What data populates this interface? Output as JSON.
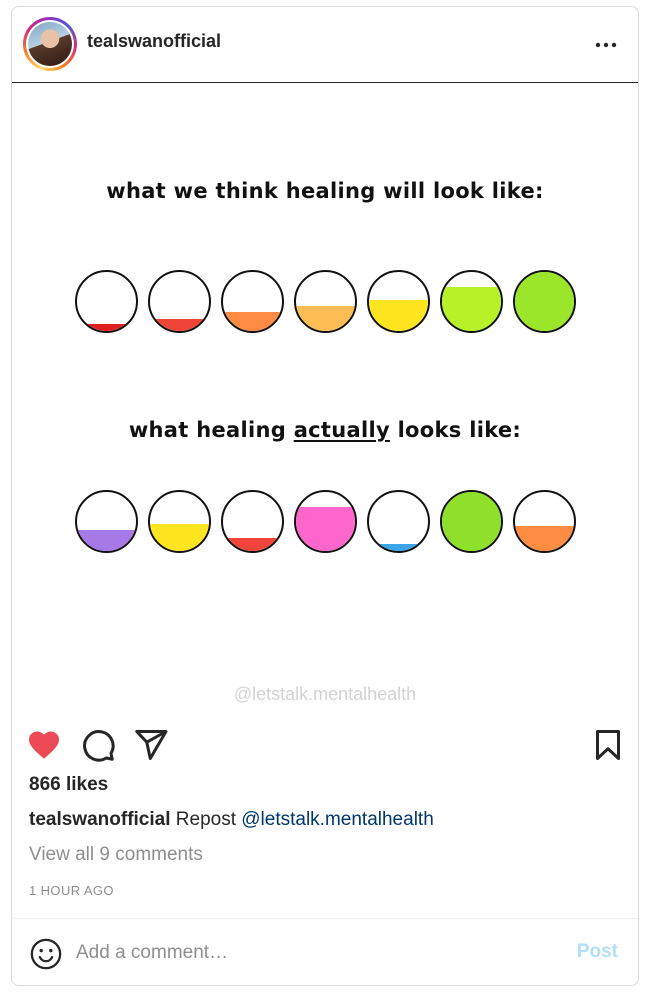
{
  "post": {
    "username": "tealswanofficial",
    "more_icon": "more-horizontal-icon"
  },
  "image": {
    "heading_top": "what we think healing will look like:",
    "heading_bottom_pre": "what healing ",
    "heading_bottom_emph": "actually",
    "heading_bottom_post": " looks like:",
    "watermark": "@letstalk.mentalhealth",
    "row_top": [
      {
        "fill": 0.12,
        "color": "#e02020"
      },
      {
        "fill": 0.2,
        "color": "#f04438"
      },
      {
        "fill": 0.33,
        "color": "#ff8c42"
      },
      {
        "fill": 0.43,
        "color": "#ffbe55"
      },
      {
        "fill": 0.53,
        "color": "#ffe51f"
      },
      {
        "fill": 0.75,
        "color": "#b6f227"
      },
      {
        "fill": 1.0,
        "color": "#9be52a"
      }
    ],
    "row_bottom": [
      {
        "fill": 0.35,
        "color": "#a779e6"
      },
      {
        "fill": 0.45,
        "color": "#ffe51f"
      },
      {
        "fill": 0.22,
        "color": "#f04438"
      },
      {
        "fill": 0.75,
        "color": "#ff66cc"
      },
      {
        "fill": 0.12,
        "color": "#3aa5e8"
      },
      {
        "fill": 1.0,
        "color": "#8ee02a"
      },
      {
        "fill": 0.43,
        "color": "#ff8c42"
      }
    ]
  },
  "actions": {
    "like_icon": "heart-filled-icon",
    "comment_icon": "comment-icon",
    "share_icon": "share-icon",
    "save_icon": "bookmark-icon",
    "liked_color": "#ed4956"
  },
  "likes_text": "866 likes",
  "caption": {
    "username": "tealswanofficial",
    "text": "Repost",
    "mention": "@letstalk.mentalhealth"
  },
  "view_comments": "View all 9 comments",
  "timestamp": "1 HOUR AGO",
  "comment_bar": {
    "placeholder": "Add a comment…",
    "post_label": "Post",
    "emoji_icon": "smiley-icon"
  }
}
